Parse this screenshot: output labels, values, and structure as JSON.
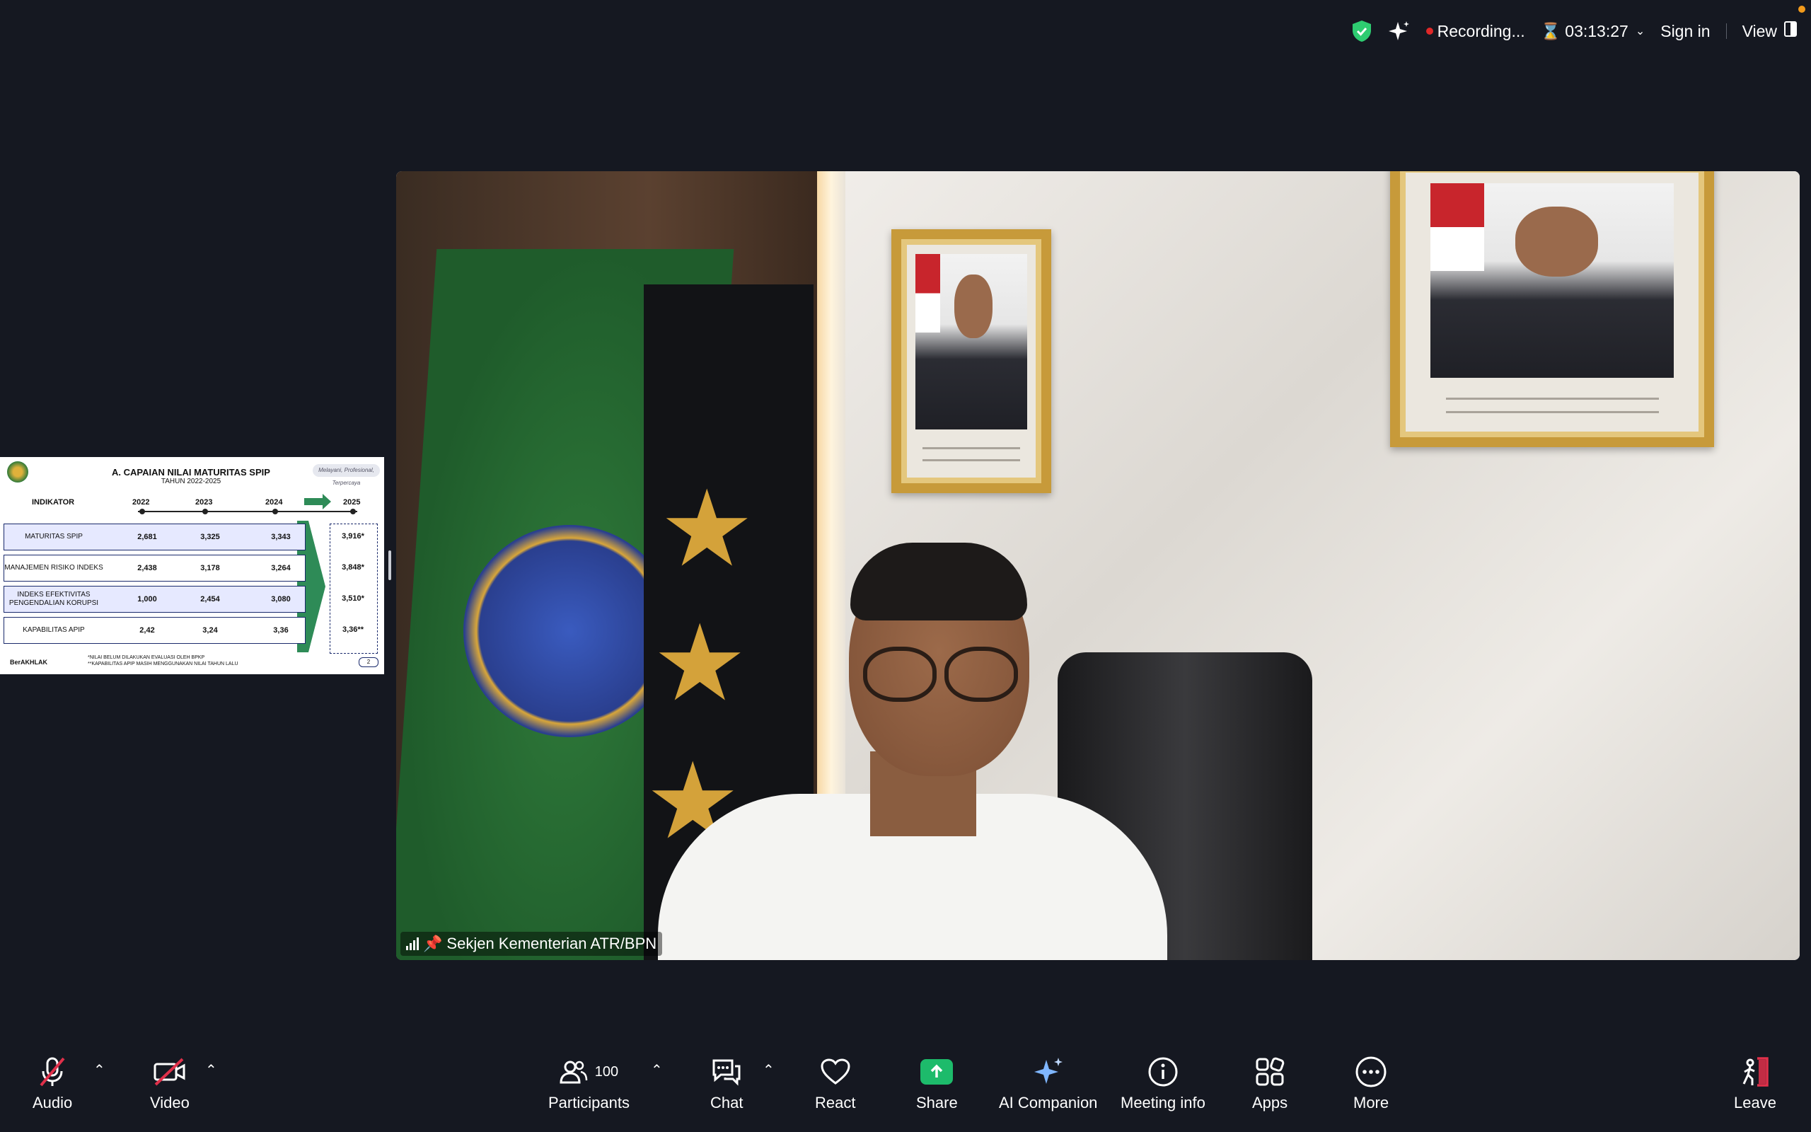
{
  "topbar": {
    "recording_label": "Recording...",
    "timer": "03:13:27",
    "sign_in": "Sign in",
    "view": "View",
    "icons": [
      "shield-check-icon",
      "sparkle-icon",
      "hourglass-icon",
      "chevron-down-icon",
      "layout-icon"
    ],
    "colors": {
      "shield": "#2ecc71",
      "recording_dot": "#e02828",
      "notification_dot": "#f29a1b"
    }
  },
  "video": {
    "participant_name": "Sekjen Kementerian ATR/BPN"
  },
  "slide": {
    "title": "A. CAPAIAN NILAI MATURITAS SPIP",
    "subtitle": "TAHUN 2022-2025",
    "signature": "Melayani, Profesional, Terpercaya",
    "header": {
      "indicator": "INDIKATOR",
      "y2022": "2022",
      "y2023": "2023",
      "y2024": "2024",
      "y2025": "2025"
    },
    "rows": [
      {
        "label": "MATURITAS SPIP",
        "v2022": "2,681",
        "v2023": "3,325",
        "v2024": "3,343",
        "v2025": "3,916*"
      },
      {
        "label": "MANAJEMEN RISIKO INDEKS",
        "v2022": "2,438",
        "v2023": "3,178",
        "v2024": "3,264",
        "v2025": "3,848*"
      },
      {
        "label": "INDEKS EFEKTIVITAS PENGENDALIAN KORUPSI",
        "v2022": "1,000",
        "v2023": "2,454",
        "v2024": "3,080",
        "v2025": "3,510*"
      },
      {
        "label": "KAPABILITAS APIP",
        "v2022": "2,42",
        "v2023": "3,24",
        "v2024": "3,36",
        "v2025": "3,36**"
      }
    ],
    "footnote1": "*NILAI BELUM DILAKUKAN EVALUASI OLEH BPKP",
    "footnote2": "**KAPABILITAS APIP MASIH MENGGUNAKAN NILAI TAHUN LALU",
    "brand": "BerAKHLAK",
    "page": "2"
  },
  "toolbar": {
    "audio": "Audio",
    "video": "Video",
    "participants": "Participants",
    "participants_count": "100",
    "chat": "Chat",
    "react": "React",
    "share": "Share",
    "ai_companion": "AI Companion",
    "meeting_info": "Meeting info",
    "apps": "Apps",
    "more": "More",
    "leave": "Leave",
    "colors": {
      "share": "#1dbb6b",
      "muted_slash": "#e0304a",
      "leave_door": "#e0304a"
    }
  }
}
